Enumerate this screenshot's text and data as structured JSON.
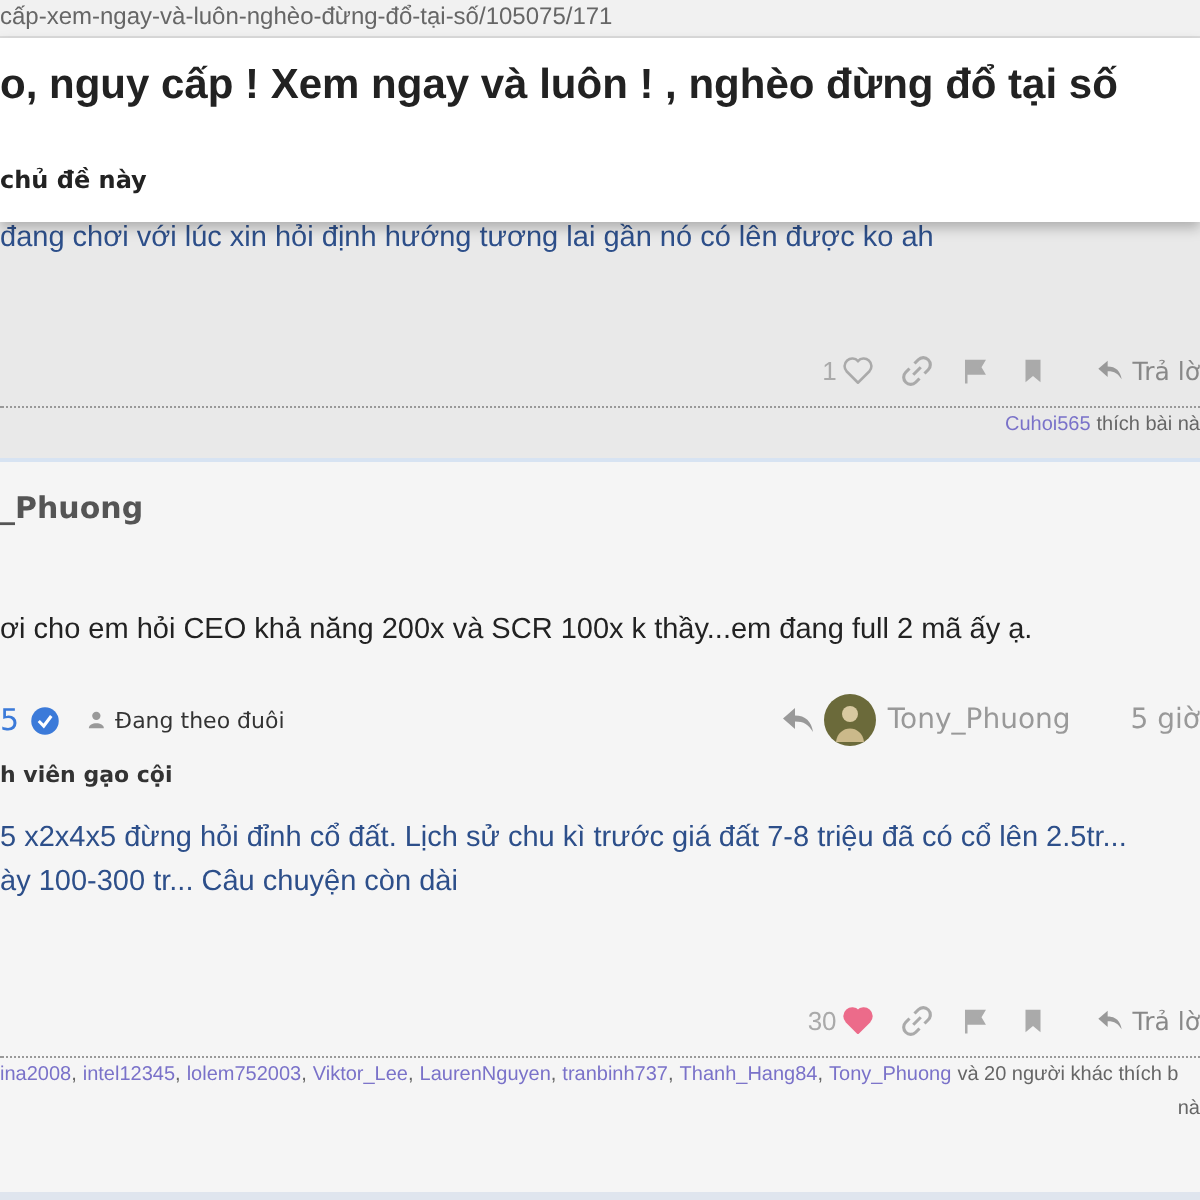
{
  "address_bar": {
    "url": "cấp-xem-ngay-và-luôn-nghèo-đừng-đổ-tại-số/105075/171"
  },
  "topic_header": {
    "title": "o, nguy cấp ! Xem ngay và luôn ! , nghèo đừng đổ tại số",
    "subtitle": "chủ đề này"
  },
  "posts": [
    {
      "kind": "previous",
      "body": "đang chơi với lúc xin hỏi định hướng tương lai gần nó có lên được ko ah",
      "like_count": "1",
      "liked": false,
      "reply_label": "Trả lờ",
      "likers": [
        {
          "name": "Cuhoi565"
        }
      ],
      "likers_suffix": "thích bài nà"
    },
    {
      "kind": "current",
      "author": "_Phuong",
      "body": "ơi cho em hỏi CEO khả năng 200x và SCR 100x k thầy...em đang full 2 mã ấy ạ.",
      "quote": {
        "author": "5",
        "verified": true,
        "status": "Đang theo đuôi",
        "reply_to": "Tony_Phuong",
        "time": "5 giờ",
        "rank": "h viên gạo cội",
        "lines": [
          "5 x2x4x5 đừng hỏi đỉnh cổ đất. Lịch sử chu kì trước giá đất 7-8 triệu đã có cổ lên 2.5tr...",
          "ày 100-300 tr... Câu chuyện còn dài"
        ]
      },
      "like_count": "30",
      "liked": true,
      "reply_label": "Trả lờ",
      "liker_separator": ",",
      "likers": [
        {
          "name": "ina2008"
        },
        {
          "name": "intel12345"
        },
        {
          "name": "lolem752003"
        },
        {
          "name": "Viktor_Lee"
        },
        {
          "name": "LaurenNguyen"
        },
        {
          "name": "tranbinh737"
        },
        {
          "name": "Thanh_Hang84"
        },
        {
          "name": "Tony_Phuong"
        }
      ],
      "likers_suffix": "và 20 người khác thích b",
      "likers_tail": "nà"
    }
  ]
}
